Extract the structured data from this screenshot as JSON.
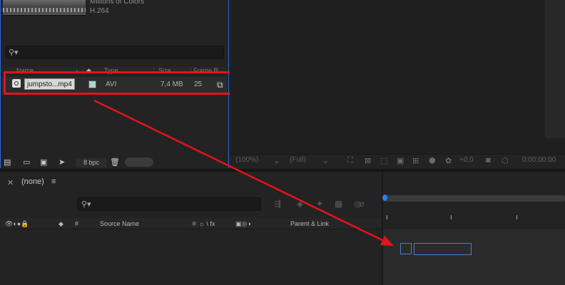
{
  "project": {
    "thumb_meta": [
      "Millions of Colors",
      "H.264"
    ],
    "columns": {
      "name": "Name",
      "type": "Type",
      "size": "Size",
      "frame_rate": "Frame R..."
    },
    "items": [
      {
        "name": "jumpsto...mp4",
        "type": "AVI",
        "size": "7,4 MB",
        "frame_rate": "25",
        "label_color": "#a9d7cf"
      }
    ],
    "bpc": "8 bpc"
  },
  "viewer": {
    "zoom": "(100%)",
    "resolution": "(Full)",
    "exposure": "+0,0",
    "timecode": "0:00:00:00"
  },
  "timeline": {
    "tab_title": "(none)",
    "columns": {
      "hash": "#",
      "source_name": "Source Name",
      "switches": "⚛ ☼ \\ fx",
      "parent_link": "Parent & Link"
    }
  },
  "annotation": {
    "highlight_color": "#e0141a",
    "arrow_color": "#e0141a"
  },
  "accent_color": "#2d6ad6"
}
